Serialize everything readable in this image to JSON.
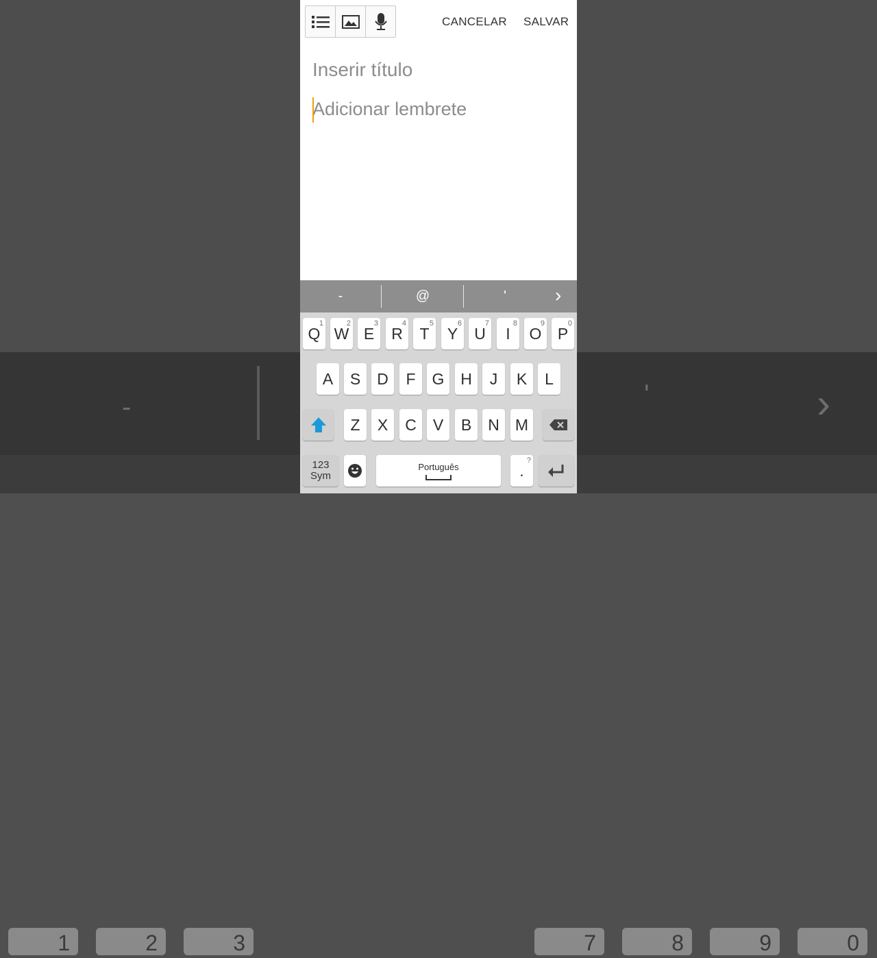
{
  "top_actions": {
    "cancel": "CANCELAR",
    "save": "SALVAR"
  },
  "toolbar": {
    "icons": [
      "list-icon",
      "image-icon",
      "microphone-icon"
    ]
  },
  "editor": {
    "title_placeholder": "Inserir título",
    "body_placeholder": "Adicionar lembrete"
  },
  "suggestions": [
    "-",
    "@",
    "'"
  ],
  "keyboard": {
    "row1": [
      {
        "key": "Q",
        "alt": "1"
      },
      {
        "key": "W",
        "alt": "2"
      },
      {
        "key": "E",
        "alt": "3"
      },
      {
        "key": "R",
        "alt": "4"
      },
      {
        "key": "T",
        "alt": "5"
      },
      {
        "key": "Y",
        "alt": "6"
      },
      {
        "key": "U",
        "alt": "7"
      },
      {
        "key": "I",
        "alt": "8"
      },
      {
        "key": "O",
        "alt": "9"
      },
      {
        "key": "P",
        "alt": "0"
      }
    ],
    "row2": [
      "A",
      "S",
      "D",
      "F",
      "G",
      "H",
      "J",
      "K",
      "L"
    ],
    "row3": [
      "Z",
      "X",
      "C",
      "V",
      "B",
      "N",
      "M"
    ],
    "sym_label_line1": "123",
    "sym_label_line2": "Sym",
    "space_label": "Português",
    "period_label": ".",
    "period_hint": "?"
  },
  "background": {
    "suggestions": [
      "-",
      "'"
    ],
    "keys": [
      "1",
      "2",
      "3",
      "7",
      "8",
      "9",
      "0"
    ]
  },
  "colors": {
    "accent_shift": "#1a9ad6",
    "cursor": "#f2a100"
  }
}
